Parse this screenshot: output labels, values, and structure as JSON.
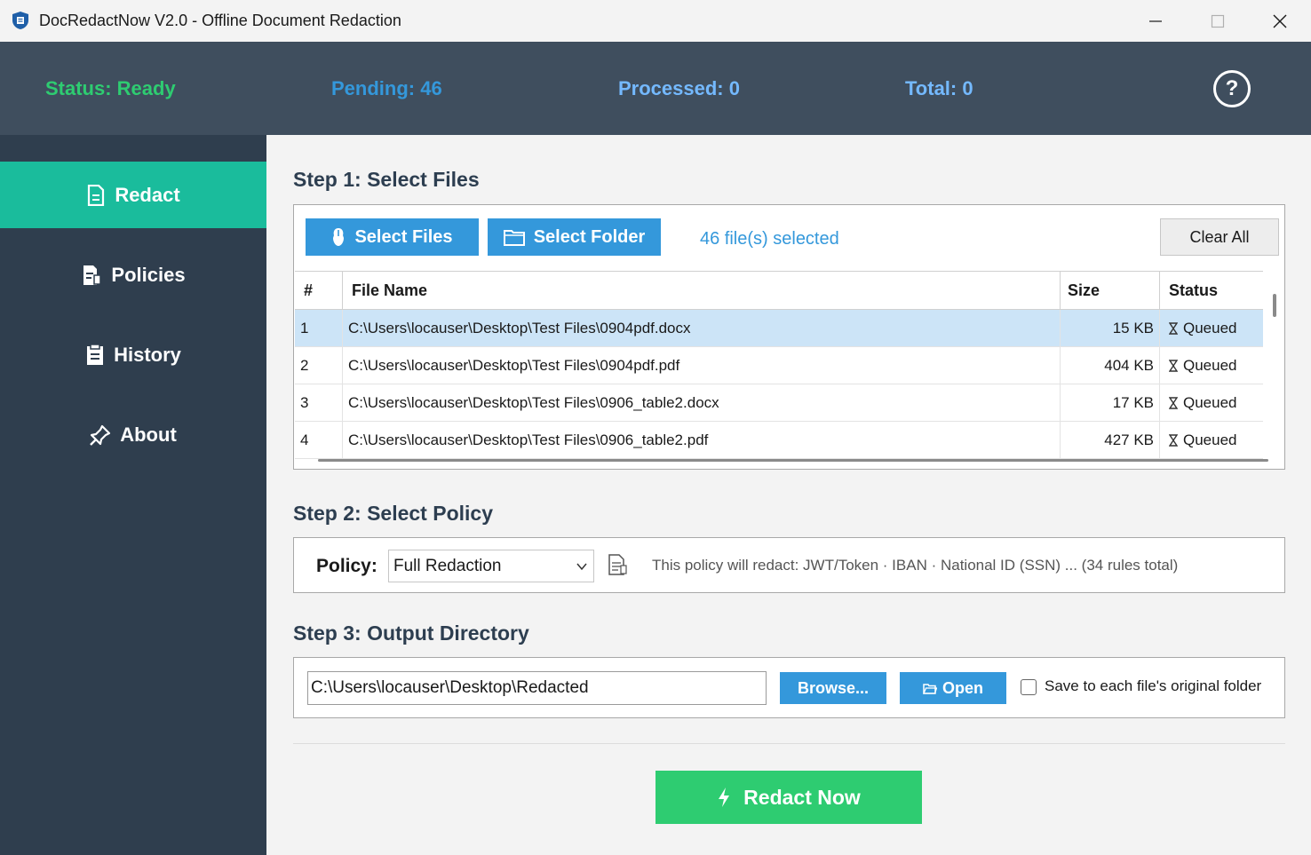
{
  "window": {
    "title": "DocRedactNow V2.0 - Offline Document Redaction"
  },
  "status": {
    "ready": "Status: Ready",
    "pending": "Pending: 46",
    "processed": "Processed: 0",
    "total": "Total: 0",
    "help_label": "?"
  },
  "sidebar": {
    "items": [
      {
        "label": "Redact",
        "icon": "document-icon",
        "active": true
      },
      {
        "label": "Policies",
        "icon": "policy-icon",
        "active": false
      },
      {
        "label": "History",
        "icon": "history-icon",
        "active": false
      },
      {
        "label": "About",
        "icon": "pin-icon",
        "active": false
      }
    ]
  },
  "step1": {
    "title": "Step 1: Select Files",
    "select_files_label": "Select Files",
    "select_folder_label": "Select Folder",
    "selected_count": "46 file(s) selected",
    "clear_all_label": "Clear All",
    "columns": [
      "#",
      "File Name",
      "Size",
      "Status"
    ],
    "rows": [
      {
        "num": "1",
        "name": "C:\\Users\\locauser\\Desktop\\Test Files\\0904pdf.docx",
        "size": "15 KB",
        "status": "Queued"
      },
      {
        "num": "2",
        "name": "C:\\Users\\locauser\\Desktop\\Test Files\\0904pdf.pdf",
        "size": "404 KB",
        "status": "Queued"
      },
      {
        "num": "3",
        "name": "C:\\Users\\locauser\\Desktop\\Test Files\\0906_table2.docx",
        "size": "17 KB",
        "status": "Queued"
      },
      {
        "num": "4",
        "name": "C:\\Users\\locauser\\Desktop\\Test Files\\0906_table2.pdf",
        "size": "427 KB",
        "status": "Queued"
      }
    ]
  },
  "step2": {
    "title": "Step 2: Select Policy",
    "policy_label": "Policy:",
    "policy_value": "Full Redaction",
    "description": "This policy will redact: JWT/Token · IBAN · National ID (SSN) ... (34 rules total)"
  },
  "step3": {
    "title": "Step 3: Output Directory",
    "output_path": "C:\\Users\\locauser\\Desktop\\Redacted",
    "browse_label": "Browse...",
    "open_label": "Open",
    "save_original_label": "Save to each file's original folder",
    "save_original_checked": false
  },
  "action": {
    "redact_now_label": "Redact Now"
  },
  "colors": {
    "accent_teal": "#1abc9c",
    "accent_blue": "#3498db",
    "accent_green": "#2ecc71",
    "header_bg": "#3f4e5e",
    "sidebar_bg": "#2f3e4e"
  }
}
